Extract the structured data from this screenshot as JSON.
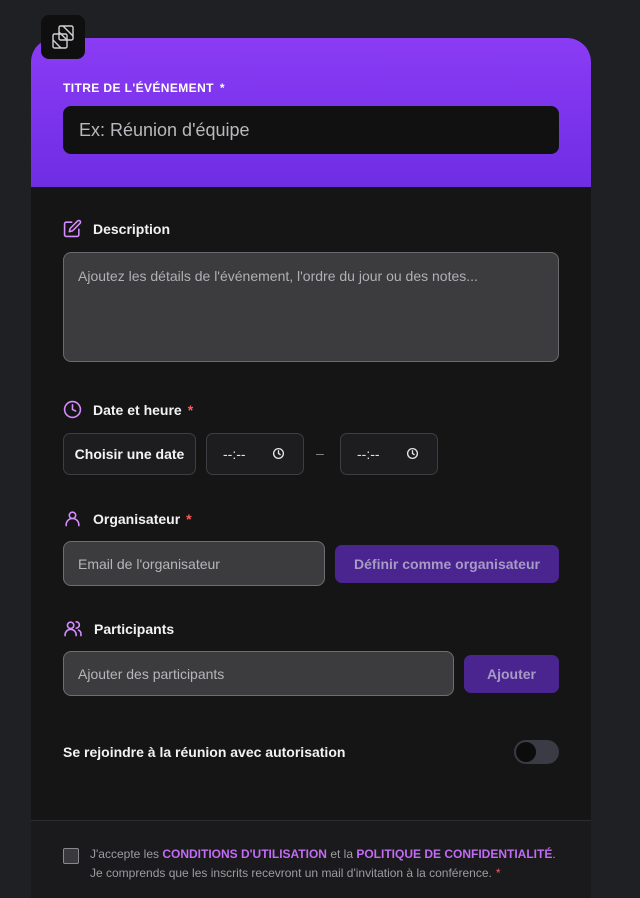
{
  "hero": {
    "label": "TITRE DE L'ÉVÉNEMENT",
    "required_mark": "*",
    "title_placeholder": "Ex: Réunion d'équipe"
  },
  "description": {
    "label": "Description",
    "placeholder": "Ajoutez les détails de l'événement, l'ordre du jour ou des notes..."
  },
  "datetime": {
    "label": "Date et heure",
    "required_mark": "*",
    "date_button": "Choisir une date",
    "start_time": "--:--",
    "end_time": "--:--",
    "separator": "–"
  },
  "organizer": {
    "label": "Organisateur",
    "required_mark": "*",
    "email_placeholder": "Email de l'organisateur",
    "set_button": "Définir comme organisateur"
  },
  "participants": {
    "label": "Participants",
    "input_placeholder": "Ajouter des participants",
    "add_button": "Ajouter"
  },
  "authorization": {
    "label": "Se rejoindre à la réunion avec autorisation",
    "enabled": false
  },
  "footer": {
    "terms_prefix": "J'accepte les",
    "terms_link": "CONDITIONS D'UTILISATION",
    "terms_mid": "et la",
    "privacy_link": "POLITIQUE DE CONFIDENTIALITÉ",
    "terms_suffix": ". Je comprends que les inscrits recevront un mail d'invitation à la conférence.",
    "required_mark": "*"
  },
  "colors": {
    "accent": "#7c33ef",
    "button": "#4a2590",
    "link": "#c26bf5",
    "required": "#ff5a5a"
  }
}
